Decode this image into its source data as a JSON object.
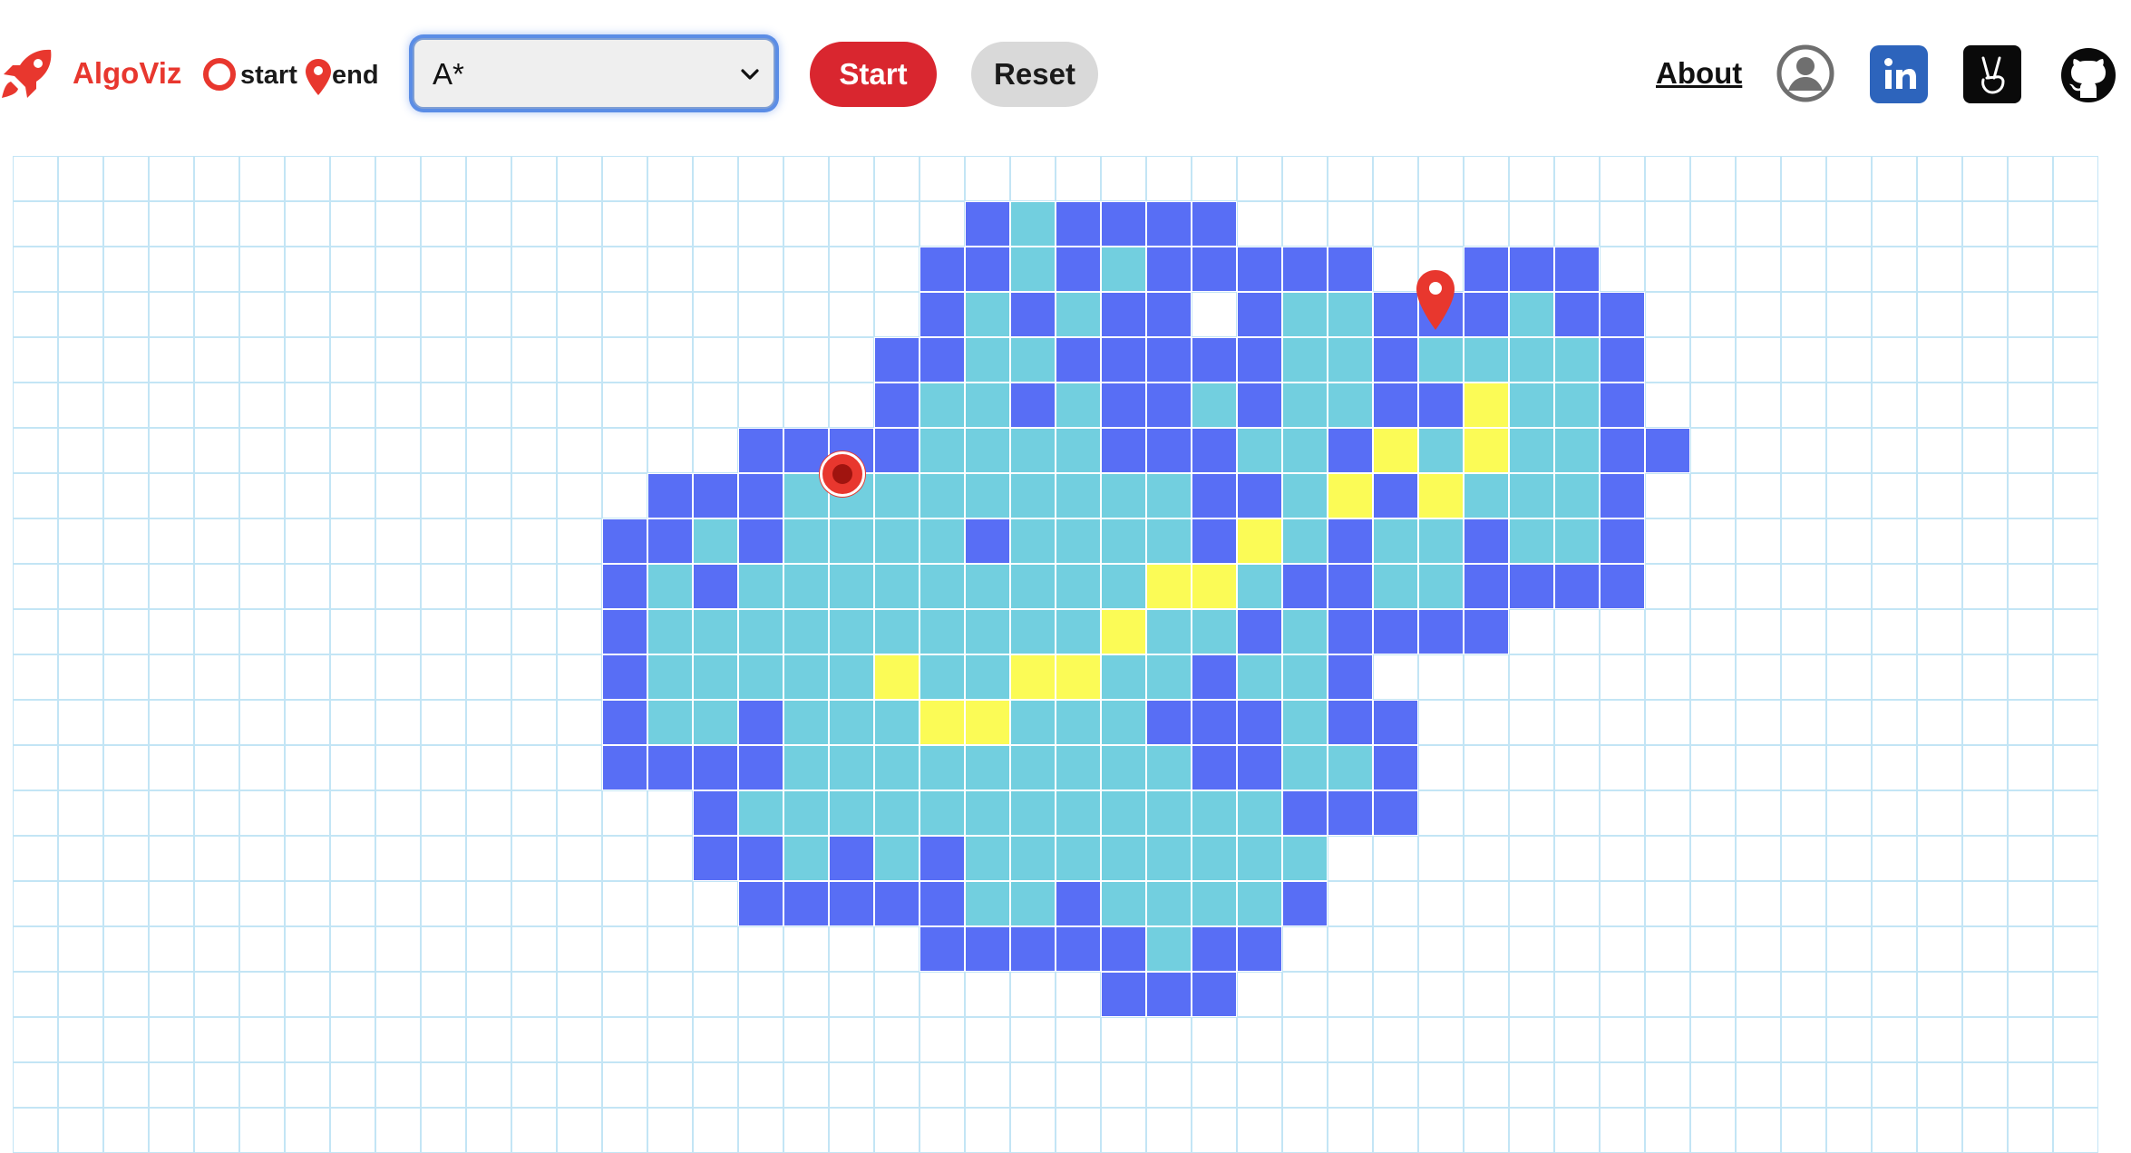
{
  "header": {
    "brand": "AlgoViz",
    "legend": {
      "start_label": "start",
      "end_label": "end"
    },
    "algorithm_select": {
      "selected": "A*"
    },
    "start_label": "Start",
    "reset_label": "Reset",
    "about_label": "About",
    "icons": {
      "logo": "rocket-icon",
      "start_legend": "start-ring-icon",
      "end_legend": "map-pin-icon",
      "profile": "user-circle-icon",
      "linkedin": "linkedin-icon",
      "angellist": "angellist-icon",
      "github": "github-icon"
    }
  },
  "colors": {
    "brand": "#e8372e",
    "start_button": "#d9262f",
    "reset_button": "#d9d9d9",
    "visited": "#72cfdf",
    "frontier": "#586ef5",
    "path": "#fbfb56",
    "grid_line": "#c3e5f5",
    "linkedin": "#2d64bc"
  },
  "grid": {
    "cols": 46,
    "rows": 22,
    "start": [
      10,
      18
    ],
    "end": [
      5,
      31
    ],
    "cells": [
      "..............................................",
      ".....................FVFFFF...................",
      "....................FFVFVFFFFF..FFF...........",
      "....................FVFVFF.FVVFFFVFF..........",
      "...................FFVVFFFFFVVFVVVVF..........",
      "...................FVVFVFFVFVVFFYVVF..........",
      "................FFFFVVVVFFFVVFYVYVVFF.........",
      "..............FFFVVVVVVVVVFFVYFYVVVF..........",
      ".............FFVFVVVVFVVVVFYVFVVFVVF..........",
      ".............FVFVVVVVVVVVYYVFFVVFFFF..........",
      ".............FVVVVVVVVVVYVVFVFFFF.............",
      ".............FVVVVVYVVYYVVFVVF................",
      ".............FVVFVVVYYVVVFFFVFF...............",
      ".............FFFFVVVVVVVVVFFVVF...............",
      "...............FVVVVVVVVVVVVFFF...............",
      "...............FFVFVFVVVVVVVV.................",
      "................FFFFFVVFVVVVF.................",
      "....................FFFFFVFF..................",
      "........................FFF...................",
      "..............................................",
      "..............................................",
      ".............................................."
    ]
  }
}
